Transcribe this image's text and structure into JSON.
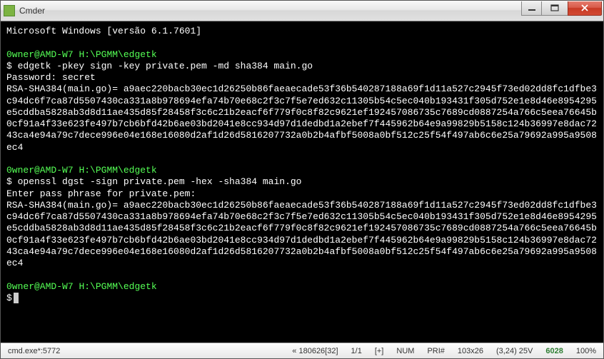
{
  "window": {
    "title": "Cmder"
  },
  "terminal": {
    "banner": "Microsoft Windows [versão 6.1.7601]",
    "prompt1_user": "0wner@AMD-W7",
    "prompt1_path": "H:\\PGMM\\edgetk",
    "cmd1": "$ edgetk -pkey sign -key private.pem -md sha384 main.go",
    "pwline": "Password: secret",
    "hash1": "RSA-SHA384(main.go)= a9aec220bacb30ec1d26250b86faeaecade53f36b540287188a69f1d11a527c2945f73ed02dd8fc1dfbe3c94dc6f7ca87d5507430ca331a8b978694efa74b70e68c2f3c7f5e7ed632c11305b54c5ec040b193431f305d752e1e8d46e8954295e5cddba5828ab3d8d11ae435d85f28458f3c6c21b2eacf6f779f0c8f82c9621ef192457086735c7689cd0887254a766c5eea76645b0cf91a4f33e623fe497b7cb6bfd42b6ae03bd2041e8cc934d97d1dedbd1a2ebef7f445962b64e9a99829b5158c124b36997e8dac7243ca4e94a79c7dece996e04e168e16080d2af1d26d5816207732a0b2b4afbf5008a0bf512c25f54f497ab6c6e25a79692a995a9508ec4",
    "prompt2_user": "0wner@AMD-W7",
    "prompt2_path": "H:\\PGMM\\edgetk",
    "cmd2": "$ openssl dgst -sign private.pem -hex -sha384 main.go",
    "passphrase": "Enter pass phrase for private.pem:",
    "hash2": "RSA-SHA384(main.go)= a9aec220bacb30ec1d26250b86faeaecade53f36b540287188a69f1d11a527c2945f73ed02dd8fc1dfbe3c94dc6f7ca87d5507430ca331a8b978694efa74b70e68c2f3c7f5e7ed632c11305b54c5ec040b193431f305d752e1e8d46e8954295e5cddba5828ab3d8d11ae435d85f28458f3c6c21b2eacf6f779f0c8f82c9621ef192457086735c7689cd0887254a766c5eea76645b0cf91a4f33e623fe497b7cb6bfd42b6ae03bd2041e8cc934d97d1dedbd1a2ebef7f445962b64e9a99829b5158c124b36997e8dac7243ca4e94a79c7dece996e04e168e16080d2af1d26d5816207732a0b2b4afbf5008a0bf512c25f54f497ab6c6e25a79692a995a9508ec4",
    "prompt3_user": "0wner@AMD-W7",
    "prompt3_path": "H:\\PGMM\\edgetk",
    "prompt3_sym": "$"
  },
  "status": {
    "shell": "cmd.exe*:5772",
    "chars": "« 180626[32]",
    "lines": "1/1",
    "insert": "[+]",
    "num": "NUM",
    "pri": "PRI#",
    "size": "103x26",
    "cursor": "(3,24) 25V",
    "col": "6028",
    "pct": "100%"
  }
}
